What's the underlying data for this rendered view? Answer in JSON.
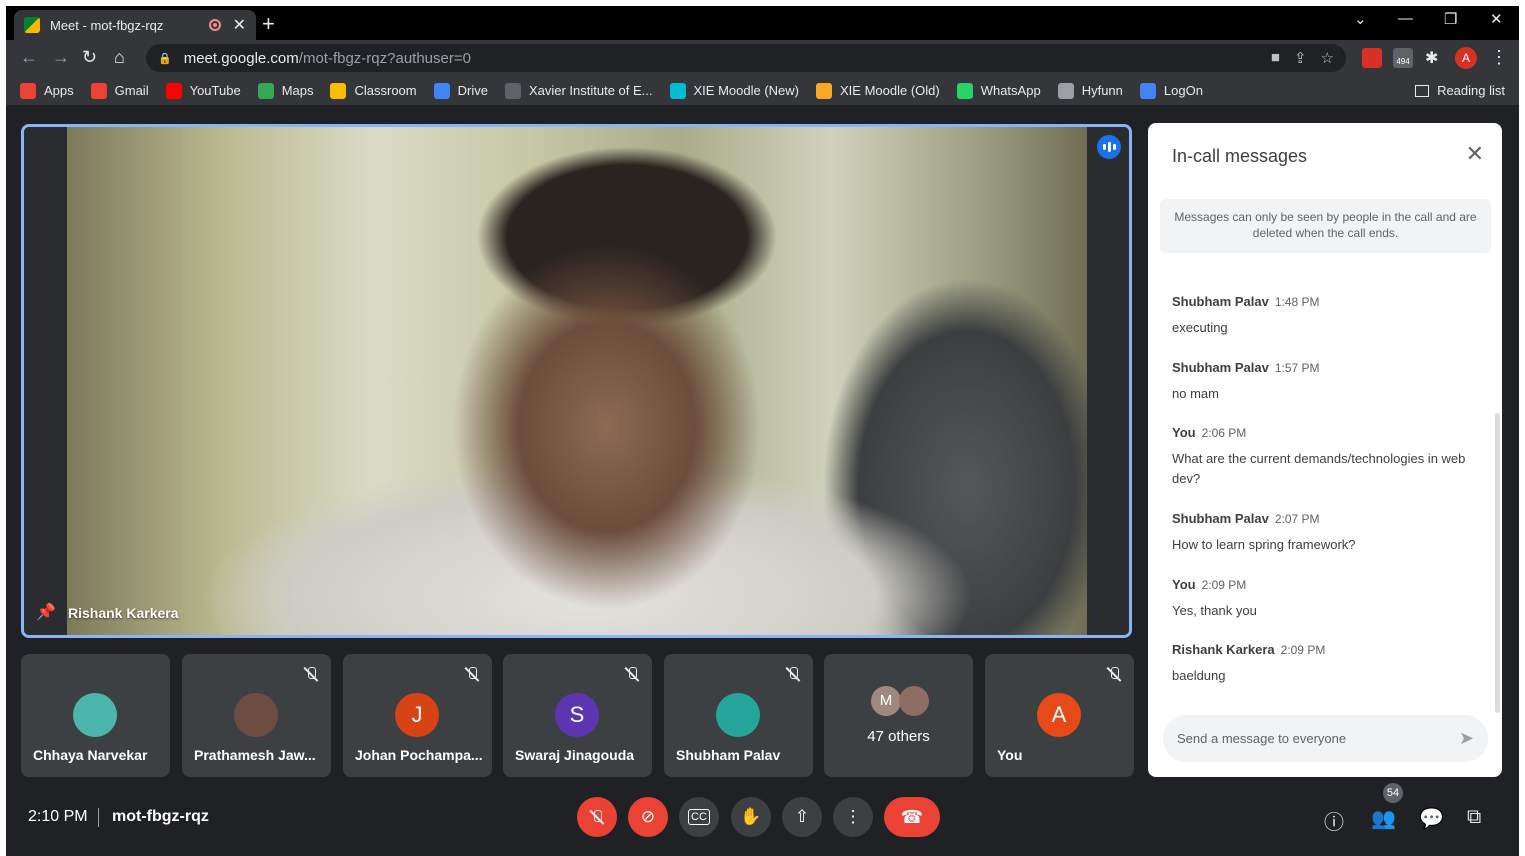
{
  "browser": {
    "tab_title": "Meet - mot-fbgz-rqz",
    "url_host": "meet.google.com",
    "url_path": "/mot-fbgz-rqz?authuser=0",
    "ext_badge": "494",
    "profile_initial": "A",
    "reading_list": "Reading list",
    "bookmarks": [
      {
        "label": "Apps",
        "color": "#ea4335"
      },
      {
        "label": "Gmail",
        "color": "#ea4335"
      },
      {
        "label": "YouTube",
        "color": "#ff0000"
      },
      {
        "label": "Maps",
        "color": "#34a853"
      },
      {
        "label": "Classroom",
        "color": "#fbbc04"
      },
      {
        "label": "Drive",
        "color": "#4285f4"
      },
      {
        "label": "Xavier Institute of E...",
        "color": "#5f6368"
      },
      {
        "label": "XIE Moodle (New)",
        "color": "#00bcd4"
      },
      {
        "label": "XIE Moodle (Old)",
        "color": "#f9a825"
      },
      {
        "label": "WhatsApp",
        "color": "#25d366"
      },
      {
        "label": "Hyfunn",
        "color": "#9aa0a6"
      },
      {
        "label": "LogOn",
        "color": "#4285f4"
      }
    ]
  },
  "main_video": {
    "name": "Rishank Karkera"
  },
  "tiles": [
    {
      "name": "Chhaya Narvekar",
      "initial": "",
      "color": "#4db6ac",
      "muted": false
    },
    {
      "name": "Prathamesh Jaw...",
      "initial": "",
      "color": "#6d4c41",
      "muted": true
    },
    {
      "name": "Johan Pochampa...",
      "initial": "J",
      "color": "#d84315",
      "muted": true
    },
    {
      "name": "Swaraj Jinagouda",
      "initial": "S",
      "color": "#5e35b1",
      "muted": true
    },
    {
      "name": "Shubham Palav",
      "initial": "",
      "color": "#26a69a",
      "muted": true
    },
    {
      "name": "You",
      "initial": "A",
      "color": "#e64a19",
      "muted": true
    }
  ],
  "others": {
    "label": "47 others",
    "initial": "M",
    "color_a": "#a1887f",
    "color_b": "#8d6e63"
  },
  "panel": {
    "title": "In-call messages",
    "notice": "Messages can only be seen by people in the call and are deleted when the call ends.",
    "messages": [
      {
        "sender": "Shubham Palav",
        "time": "1:48 PM",
        "text": "executing"
      },
      {
        "sender": "Shubham Palav",
        "time": "1:57 PM",
        "text": "no mam"
      },
      {
        "sender": "You",
        "time": "2:06 PM",
        "text": "What are the current demands/technologies in web dev?"
      },
      {
        "sender": "Shubham Palav",
        "time": "2:07 PM",
        "text": "How to learn spring framework?"
      },
      {
        "sender": "You",
        "time": "2:09 PM",
        "text": "Yes, thank you"
      },
      {
        "sender": "Rishank Karkera",
        "time": "2:09 PM",
        "text": "baeldung"
      }
    ],
    "compose_placeholder": "Send a message to everyone"
  },
  "bottom_bar": {
    "time": "2:10 PM",
    "meeting_code": "mot-fbgz-rqz",
    "participants_count": "54"
  },
  "colors": {
    "accent": "#8ab4f8",
    "danger": "#ea4335",
    "chat_active": "#8ab4f8"
  }
}
